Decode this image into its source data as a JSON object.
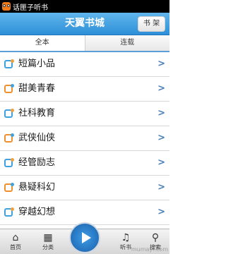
{
  "status": {
    "app_name": "话匣子听书"
  },
  "header": {
    "title": "天翼书城",
    "shelf_label": "书 架"
  },
  "tabs": [
    {
      "label": "全本",
      "active": true
    },
    {
      "label": "连载",
      "active": false
    }
  ],
  "categories": [
    {
      "label": "短篇小品"
    },
    {
      "label": "甜美青春"
    },
    {
      "label": "社科教育"
    },
    {
      "label": "武侠仙侠"
    },
    {
      "label": "经管励志"
    },
    {
      "label": "悬疑科幻"
    },
    {
      "label": "穿越幻想"
    }
  ],
  "bottom_nav": {
    "home": "首页",
    "category": "分类",
    "listen": "听书",
    "search": "搜索"
  },
  "watermark": "mumayi.com"
}
